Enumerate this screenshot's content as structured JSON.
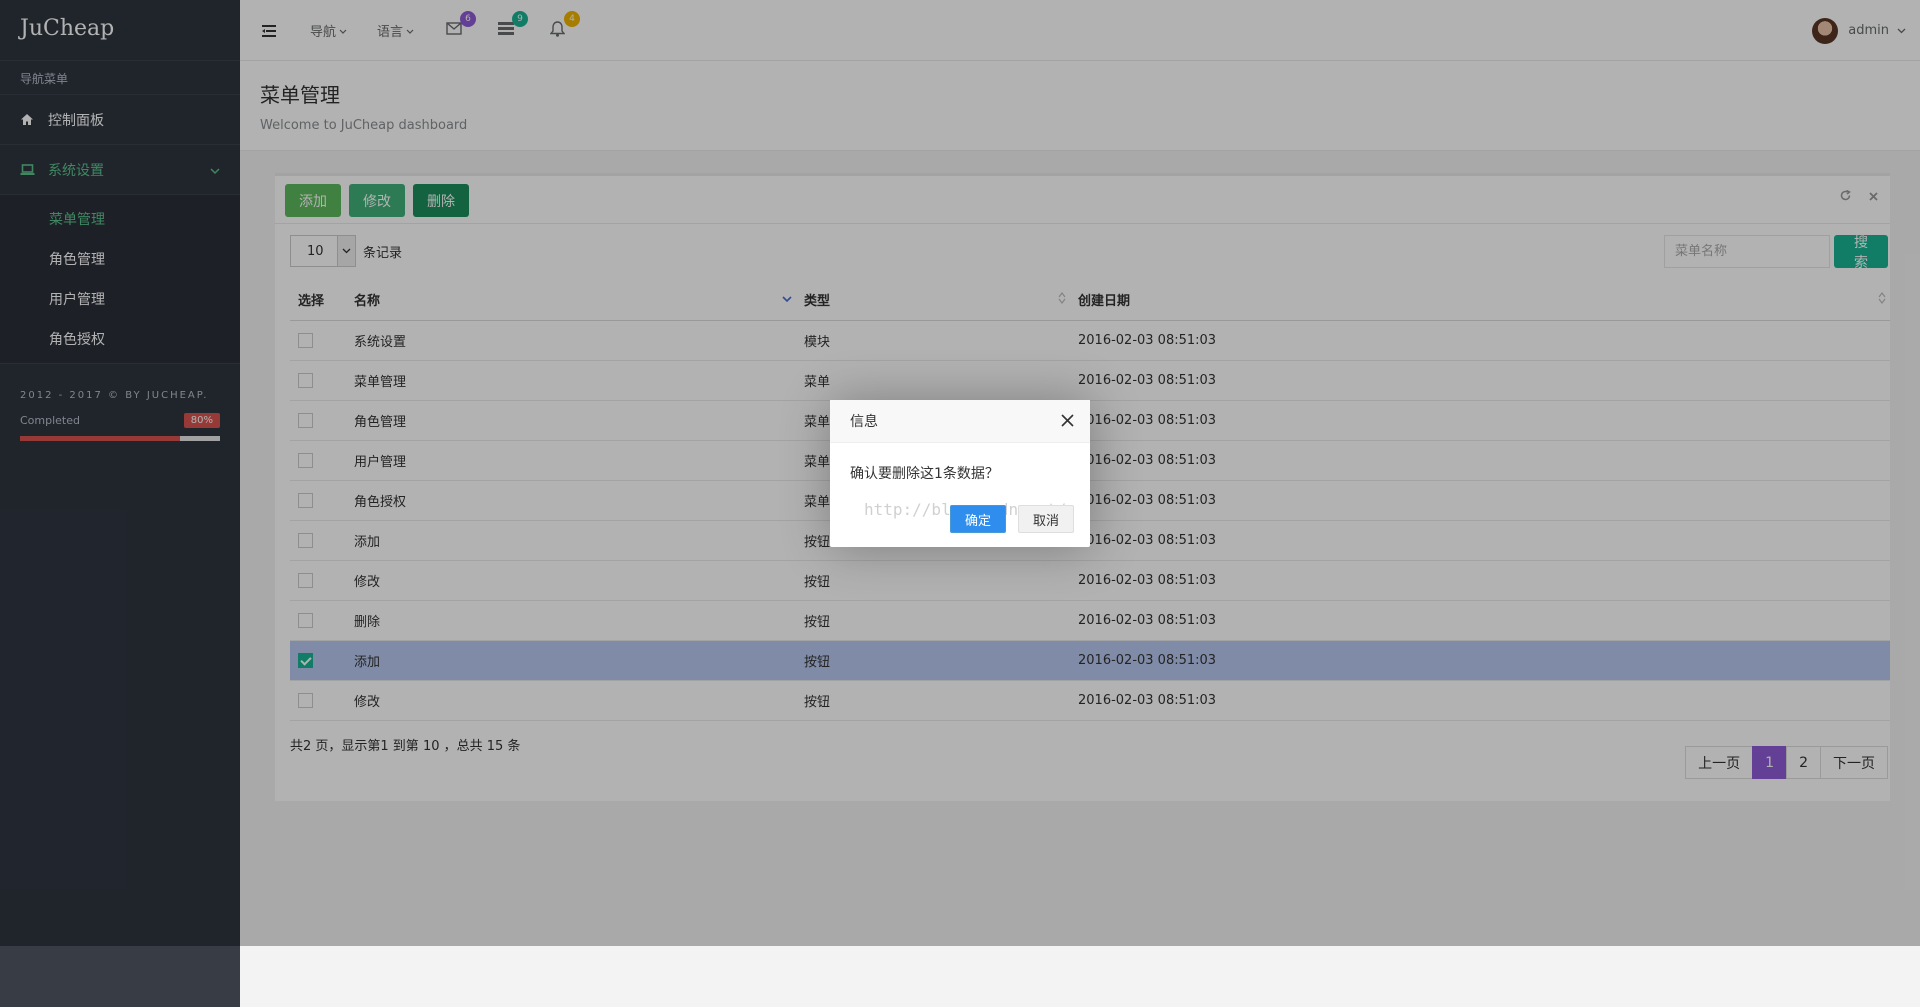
{
  "sidebar": {
    "brand": "JuCheap",
    "nav_header": "导航菜单",
    "items": [
      {
        "label": "控制面板",
        "icon": "home-icon"
      },
      {
        "label": "系统设置",
        "icon": "laptop-icon"
      }
    ],
    "submenu": [
      {
        "label": "菜单管理",
        "active": true
      },
      {
        "label": "角色管理",
        "active": false
      },
      {
        "label": "用户管理",
        "active": false
      },
      {
        "label": "角色授权",
        "active": false
      }
    ],
    "copyright": "2012 - 2017 © BY JUCHEAP.",
    "progress_label": "Completed",
    "progress_text": "80%",
    "progress_fraction": 0.8
  },
  "topbar": {
    "nav_label": "导航",
    "lang_label": "语言",
    "mail_badge": "6",
    "tasks_badge": "9",
    "alerts_badge": "4",
    "user_name": "admin",
    "colors": {
      "mail": "#8e5bd6",
      "tasks": "#1ab394",
      "alerts": "#f0b400"
    }
  },
  "heading": {
    "title": "菜单管理",
    "subtitle": "Welcome to JuCheap dashboard"
  },
  "toolbar": {
    "add_label": "添加",
    "edit_label": "修改",
    "delete_label": "删除"
  },
  "table_controls": {
    "page_length": "10",
    "length_suffix": "条记录",
    "search_placeholder": "菜单名称",
    "search_label": "搜索"
  },
  "table": {
    "headers": {
      "select": "选择",
      "name": "名称",
      "type": "类型",
      "created": "创建日期"
    },
    "rows": [
      {
        "name": "系统设置",
        "type": "模块",
        "date": "2016-02-03 08:51:03",
        "checked": false
      },
      {
        "name": "菜单管理",
        "type": "菜单",
        "date": "2016-02-03 08:51:03",
        "checked": false
      },
      {
        "name": "角色管理",
        "type": "菜单",
        "date": "2016-02-03 08:51:03",
        "checked": false
      },
      {
        "name": "用户管理",
        "type": "菜单",
        "date": "2016-02-03 08:51:03",
        "checked": false
      },
      {
        "name": "角色授权",
        "type": "菜单",
        "date": "2016-02-03 08:51:03",
        "checked": false
      },
      {
        "name": "添加",
        "type": "按钮",
        "date": "2016-02-03 08:51:03",
        "checked": false
      },
      {
        "name": "修改",
        "type": "按钮",
        "date": "2016-02-03 08:51:03",
        "checked": false
      },
      {
        "name": "删除",
        "type": "按钮",
        "date": "2016-02-03 08:51:03",
        "checked": false
      },
      {
        "name": "添加",
        "type": "按钮",
        "date": "2016-02-03 08:51:03",
        "checked": true
      },
      {
        "name": "修改",
        "type": "按钮",
        "date": "2016-02-03 08:51:03",
        "checked": false
      }
    ],
    "info": "共2 页，显示第1 到第 10 ，总共 15 条"
  },
  "pagination": {
    "prev": "上一页",
    "pages": [
      "1",
      "2"
    ],
    "current": "1",
    "next": "下一页"
  },
  "modal": {
    "title": "信息",
    "message": "确认要删除这1条数据？",
    "ok_label": "确定",
    "cancel_label": "取消",
    "watermark": "http://blog.csdn.net/"
  }
}
